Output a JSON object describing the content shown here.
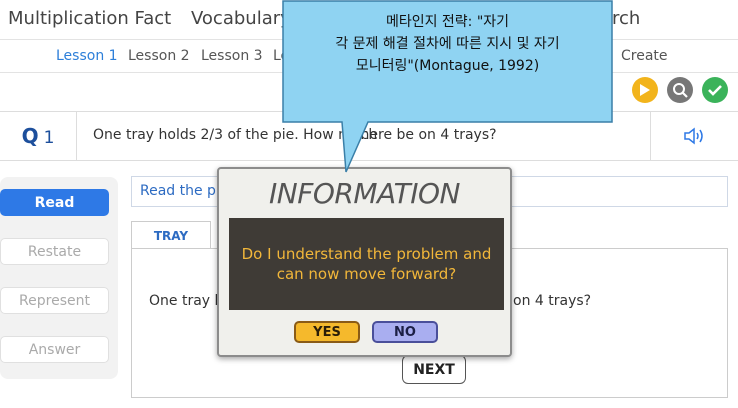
{
  "topnav": {
    "items": [
      "Multiplication Fact",
      "Vocabulary",
      "rch"
    ]
  },
  "lessons": {
    "items": [
      "Lesson 1",
      "Lesson 2",
      "Lesson 3",
      "Le",
      "Create"
    ],
    "active": "Lesson 1"
  },
  "status_icons": [
    "play-icon",
    "search-icon",
    "check-icon"
  ],
  "question": {
    "label": "Q",
    "number": "1",
    "text_left": "One tray holds 2/3 of the pie. How much",
    "text_right": "a there be on 4 trays?"
  },
  "steps": {
    "read": "Read",
    "restate": "Restate",
    "represent": "Represent",
    "answer": "Answer"
  },
  "work": {
    "read_label": "Read the pro",
    "tab": "TRAY",
    "text_left": "One tray ho",
    "text_right": "on 4 trays?",
    "next": "NEXT"
  },
  "modal": {
    "title": "INFORMATION",
    "line1": "Do I understand the problem and",
    "line2": "can now move forward?",
    "yes": "YES",
    "no": "NO"
  },
  "callout": {
    "line1": "메타인지 전략: \"자기",
    "line2": "각 문제 해결 절차에 따른 지시 및 자기",
    "line3": "모니터링\"(Montague, 1992)"
  },
  "colors": {
    "accent_blue": "#2e79e6",
    "callout_fill": "#8fd3f2",
    "modal_text": "#f2b73a",
    "yes_button": "#f5b92c",
    "no_button": "#a9aef0"
  }
}
